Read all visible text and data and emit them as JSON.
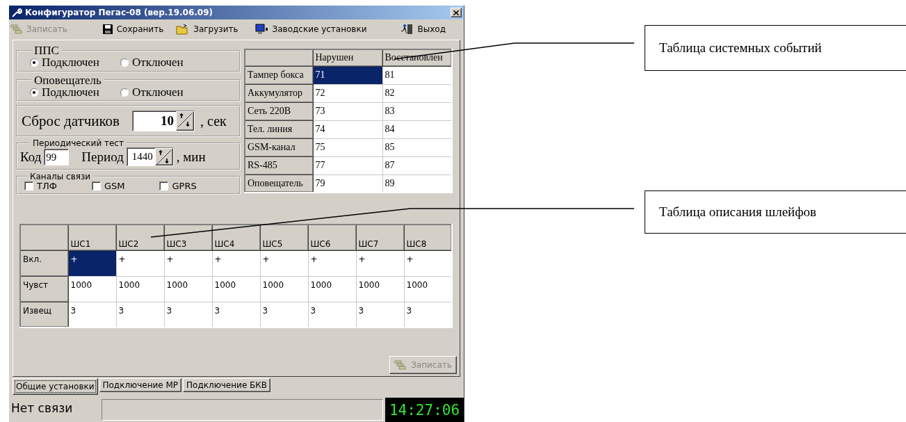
{
  "window": {
    "title": "Конфигуратор Пегас-08 (вер.19.06.09)"
  },
  "toolbar": [
    {
      "kind": "write",
      "label": "Записать",
      "disabled": true
    },
    {
      "kind": "save",
      "label": "Сохранить",
      "disabled": false
    },
    {
      "kind": "load",
      "label": "Загрузить",
      "disabled": false
    },
    {
      "kind": "factory",
      "label": "Заводские установки",
      "disabled": false
    },
    {
      "kind": "exit",
      "label": "Выход",
      "disabled": false
    }
  ],
  "pps": {
    "legend": "ППС",
    "options": [
      {
        "label": "Подключен",
        "selected": true
      },
      {
        "label": "Отключен",
        "selected": false
      }
    ]
  },
  "notifier": {
    "legend": "Оповещатель",
    "options": [
      {
        "label": "Подключен",
        "selected": true
      },
      {
        "label": "Отключен",
        "selected": false
      }
    ]
  },
  "sensor_reset": {
    "label": "Сброс датчиков",
    "value": "10",
    "unit": ", сек"
  },
  "periodic_test": {
    "legend": "Периодический тест",
    "code_label": "Код",
    "code": "99",
    "period_label": "Период",
    "period": "1440",
    "unit": ", мин"
  },
  "channels": {
    "legend": "Каналы связи",
    "items": [
      {
        "label": "ТЛФ",
        "checked": false
      },
      {
        "label": "GSM",
        "checked": false
      },
      {
        "label": "GPRS",
        "checked": false
      }
    ]
  },
  "events_table": {
    "columns": [
      "Нарушен",
      "Восстановлен"
    ],
    "rows": [
      {
        "label": "Тампер бокса",
        "cells": [
          {
            "text": "71",
            "selected": true
          },
          {
            "text": "81",
            "selected": false
          }
        ]
      },
      {
        "label": "Аккумулятор",
        "cells": [
          {
            "text": "72",
            "selected": false
          },
          {
            "text": "82",
            "selected": false
          }
        ]
      },
      {
        "label": "Сеть 220В",
        "cells": [
          {
            "text": "73",
            "selected": false
          },
          {
            "text": "83",
            "selected": false
          }
        ]
      },
      {
        "label": "Тел. линия",
        "cells": [
          {
            "text": "74",
            "selected": false
          },
          {
            "text": "84",
            "selected": false
          }
        ]
      },
      {
        "label": "GSM-канал",
        "cells": [
          {
            "text": "75",
            "selected": false
          },
          {
            "text": "85",
            "selected": false
          }
        ]
      },
      {
        "label": "RS-485",
        "cells": [
          {
            "text": "77",
            "selected": false
          },
          {
            "text": "87",
            "selected": false
          }
        ]
      },
      {
        "label": "Оповещатель",
        "cells": [
          {
            "text": "79",
            "selected": false
          },
          {
            "text": "89",
            "selected": false
          }
        ]
      }
    ]
  },
  "loops_table": {
    "columns": [
      "ШС1",
      "ШС2",
      "ШС3",
      "ШС4",
      "ШС5",
      "ШС6",
      "ШС7",
      "ШС8"
    ],
    "rows": [
      {
        "label": "Вкл.",
        "cells": [
          {
            "text": "+",
            "selected": true
          },
          {
            "text": "+",
            "selected": false
          },
          {
            "text": "+",
            "selected": false
          },
          {
            "text": "+",
            "selected": false
          },
          {
            "text": "+",
            "selected": false
          },
          {
            "text": "+",
            "selected": false
          },
          {
            "text": "+",
            "selected": false
          },
          {
            "text": "+",
            "selected": false
          }
        ]
      },
      {
        "label": "Чувст",
        "cells": [
          {
            "text": "1000",
            "selected": false
          },
          {
            "text": "1000",
            "selected": false
          },
          {
            "text": "1000",
            "selected": false
          },
          {
            "text": "1000",
            "selected": false
          },
          {
            "text": "1000",
            "selected": false
          },
          {
            "text": "1000",
            "selected": false
          },
          {
            "text": "1000",
            "selected": false
          },
          {
            "text": "1000",
            "selected": false
          }
        ]
      },
      {
        "label": "Извещ",
        "cells": [
          {
            "text": "3",
            "selected": false
          },
          {
            "text": "3",
            "selected": false
          },
          {
            "text": "3",
            "selected": false
          },
          {
            "text": "3",
            "selected": false
          },
          {
            "text": "3",
            "selected": false
          },
          {
            "text": "3",
            "selected": false
          },
          {
            "text": "3",
            "selected": false
          },
          {
            "text": "3",
            "selected": false
          }
        ]
      }
    ]
  },
  "write_button": {
    "label": "Записать",
    "disabled": true
  },
  "tabs": [
    {
      "label": "Общие установки",
      "selected": true
    },
    {
      "label": "Подключение МР",
      "selected": false
    },
    {
      "label": "Подключение БКВ",
      "selected": false
    }
  ],
  "status_bar": {
    "status": "Нет связи",
    "time": "14:27:06"
  },
  "callouts": [
    {
      "text": "Таблица системных событий"
    },
    {
      "text": "Таблица описания шлейфов"
    }
  ]
}
